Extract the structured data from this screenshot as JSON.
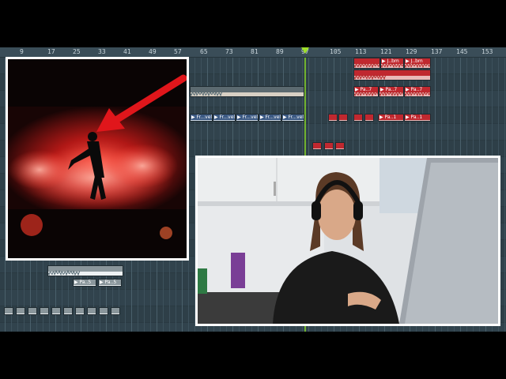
{
  "daw": {
    "ruler_ticks": [
      "9",
      "17",
      "25",
      "33",
      "41",
      "49",
      "57",
      "65",
      "73",
      "81",
      "89",
      "97",
      "105",
      "113",
      "121",
      "129",
      "137",
      "145",
      "153"
    ],
    "clips": {
      "top_right": [
        "J..bm",
        "J..bm"
      ],
      "pa7": [
        "Pa..7",
        "Pa..7",
        "Pa..7",
        "Pa..7"
      ],
      "fr_vel": [
        "Fr...vel",
        "Fr...vel",
        "Fr...vel",
        "Fr...vel",
        "Fr...vel"
      ],
      "pa1": [
        "Pa..1",
        "Pa..1"
      ],
      "pa5": [
        "Pa..5",
        "Pa..5"
      ]
    },
    "accent_color": "#9fe02a",
    "clip_color_red": "#c0282f",
    "clip_color_blue": "#3c5a84"
  },
  "overlay": {
    "album_art": "concert-photo-red-smoke",
    "arrow_color": "#e0161b",
    "webcam": "person-with-headphones-at-laptop"
  }
}
